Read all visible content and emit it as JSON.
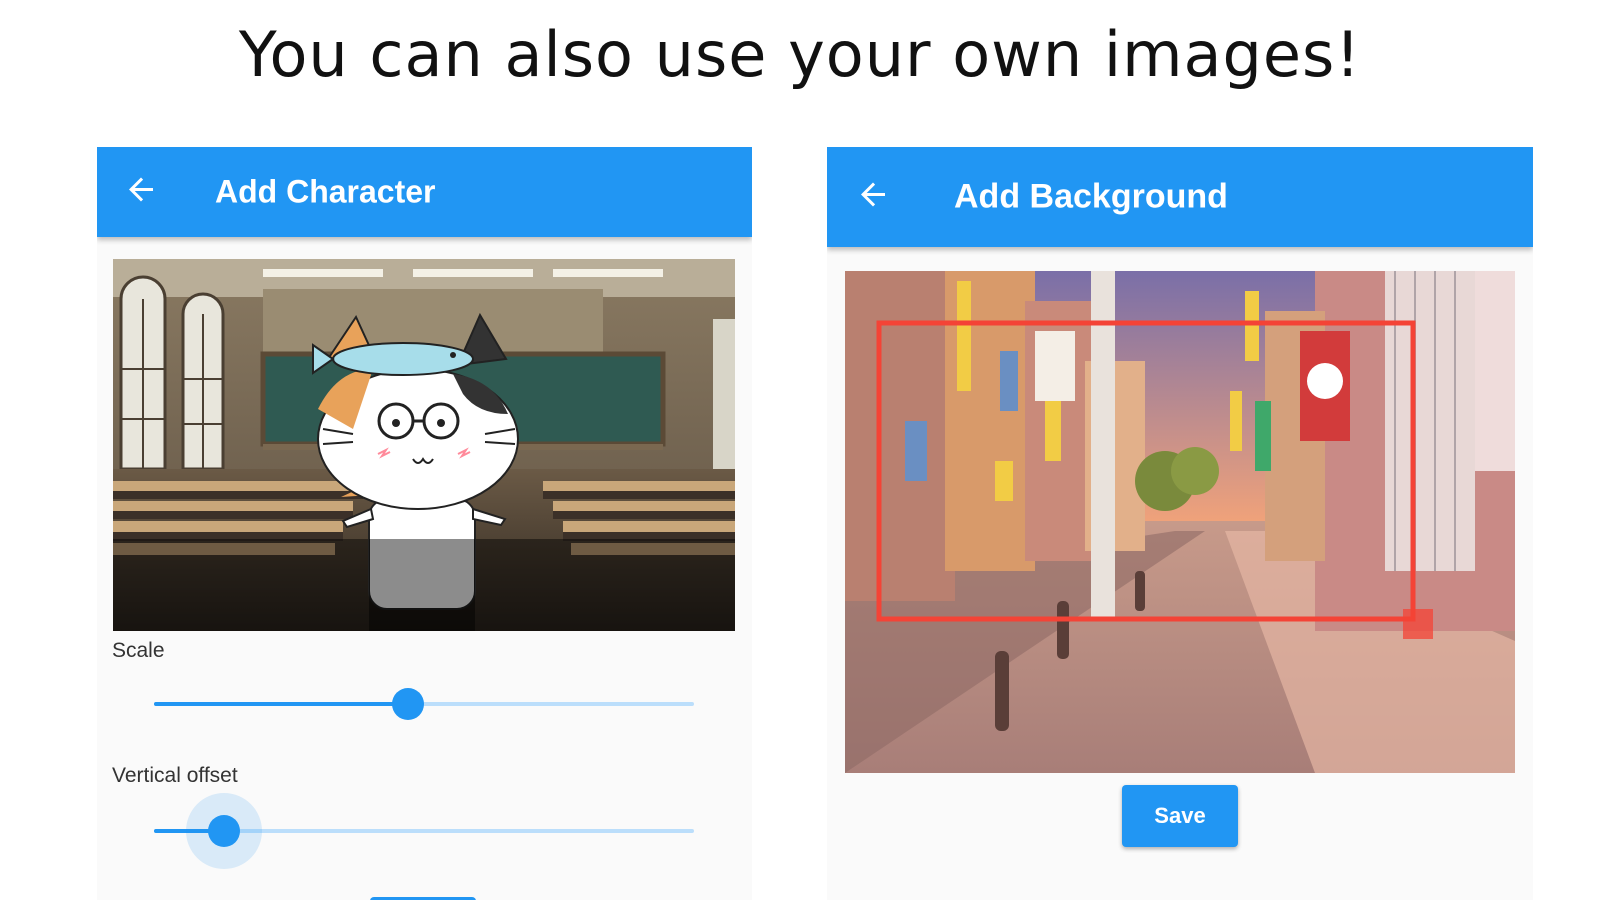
{
  "headline": "You can also use your own images!",
  "colors": {
    "accent": "#2196f3",
    "track": "#bbdefb",
    "crop": "#f44336"
  },
  "add_character": {
    "title": "Add Character",
    "back_icon": "arrow-left-icon",
    "scale": {
      "label": "Scale",
      "value": 0.47
    },
    "vertical_offset": {
      "label": "Vertical offset",
      "value": 0.13
    }
  },
  "add_background": {
    "title": "Add Background",
    "back_icon": "arrow-left-icon",
    "save_label": "Save"
  }
}
